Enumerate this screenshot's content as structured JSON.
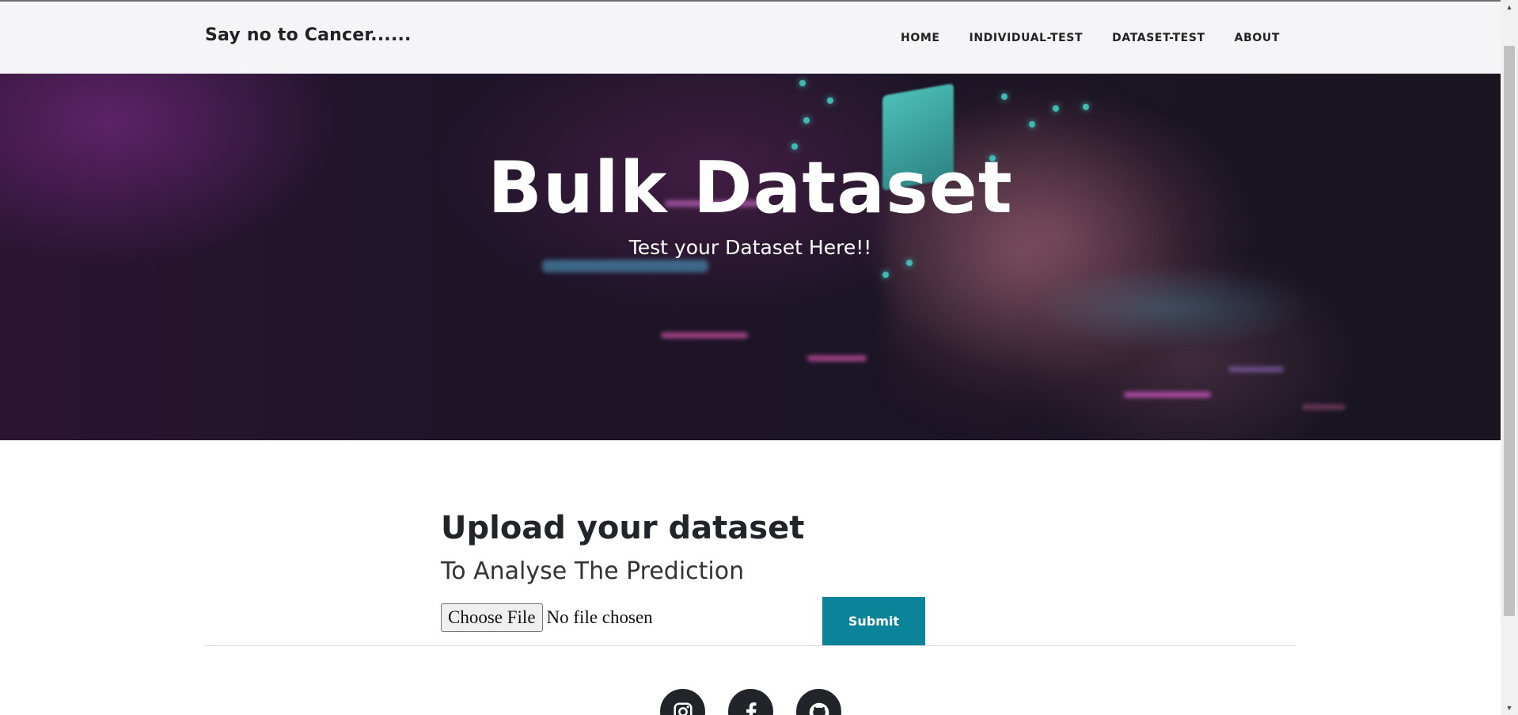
{
  "navbar": {
    "brand": "Say no to Cancer......",
    "links": [
      "HOME",
      "INDIVIDUAL-TEST",
      "DATASET-TEST",
      "ABOUT"
    ]
  },
  "hero": {
    "title": "Bulk Dataset",
    "subtitle": "Test your Dataset Here!!"
  },
  "upload": {
    "title": "Upload your dataset",
    "subtitle": "To Analyse The Prediction",
    "choose_label": "Choose File",
    "file_status": "No file chosen",
    "submit_label": "Submit"
  },
  "socials": [
    "instagram-icon",
    "facebook-icon",
    "github-icon"
  ],
  "colors": {
    "accent": "#0b8499",
    "dark": "#212529"
  }
}
